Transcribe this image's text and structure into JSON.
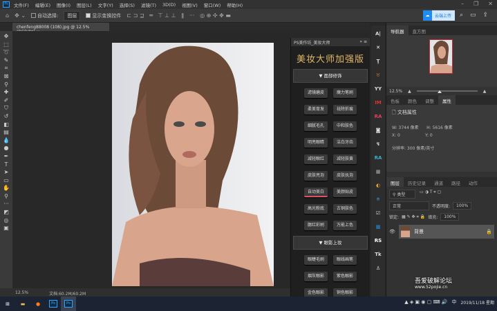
{
  "menu": {
    "items": [
      "文件(F)",
      "编辑(E)",
      "图像(I)",
      "图层(L)",
      "文字(Y)",
      "选择(S)",
      "滤镜(T)",
      "3D(D)",
      "视图(V)",
      "窗口(W)",
      "帮助(H)"
    ]
  },
  "options": {
    "auto_select": "自动选择:",
    "layer_select": "图层",
    "show_transform": "显示变换控件",
    "cloud_upload": "云端上传"
  },
  "document": {
    "tab": "chenfeng88008 (108).jpg @ 12.5%(RGB/8*)",
    "zoom": "12.5%",
    "doc_size": "文档:60.2M/60.2M"
  },
  "plugin": {
    "header": "PS美作坊_美妆大师",
    "title": "美妆大师加强版",
    "sections": [
      {
        "label": "▼ 面部修饰",
        "buttons": [
          "滤镜磨皮",
          "魔力笔刷",
          "柔美育发",
          "祛除折痕",
          "细腻毛孔",
          "中和肤色",
          "明亮眼睛",
          "洁白牙齿",
          "减轻眼红",
          "减轻肤黄",
          "皮肤亮泡",
          "皮肤抚泡",
          "自动美白",
          "美颜贴皮",
          "高光粉底",
          "古铜肤色",
          "腮红彩刷",
          "万能上色"
        ]
      },
      {
        "label": "▼ 眼影上妆",
        "buttons": [
          "眼睫毛刷",
          "眼线画笔",
          "烟灰眼影",
          "紫色眼影",
          "金色眼影",
          "铜色眼影"
        ]
      }
    ],
    "active_button": "自动美白"
  },
  "strip": [
    "A|",
    "✕",
    "Ţ",
    "♉",
    "YY",
    "IM",
    "RA",
    "◙",
    "↯",
    "RA",
    "▦",
    "◐",
    "⌾",
    "☑",
    "▩",
    "RS",
    "Tk",
    "♙"
  ],
  "navigator": {
    "tabs": [
      "导航器",
      "直方图"
    ],
    "zoom": "12.5%"
  },
  "properties": {
    "tabs": [
      "色板",
      "颜色",
      "调整",
      "属性"
    ],
    "heading": "文档属性",
    "w": "W: 3744 像素",
    "h": "H: 5616 像素",
    "x": "X: 0",
    "y": "Y: 0",
    "resolution": "分辨率: 300 像素/英寸"
  },
  "layers": {
    "tabs": [
      "图层",
      "历史记录",
      "通道",
      "路径",
      "动作"
    ],
    "filter": "类型",
    "blend": "正常",
    "opacity_label": "不透明度:",
    "opacity": "100%",
    "lock_label": "锁定:",
    "fill_label": "填充:",
    "fill": "100%",
    "layer_name": "背景"
  },
  "watermark": {
    "line1": "吾爱破解论坛",
    "line2": "www.52pojie.cn"
  },
  "taskbar": {
    "ime": "中",
    "date": "2019/11/18 星期"
  }
}
